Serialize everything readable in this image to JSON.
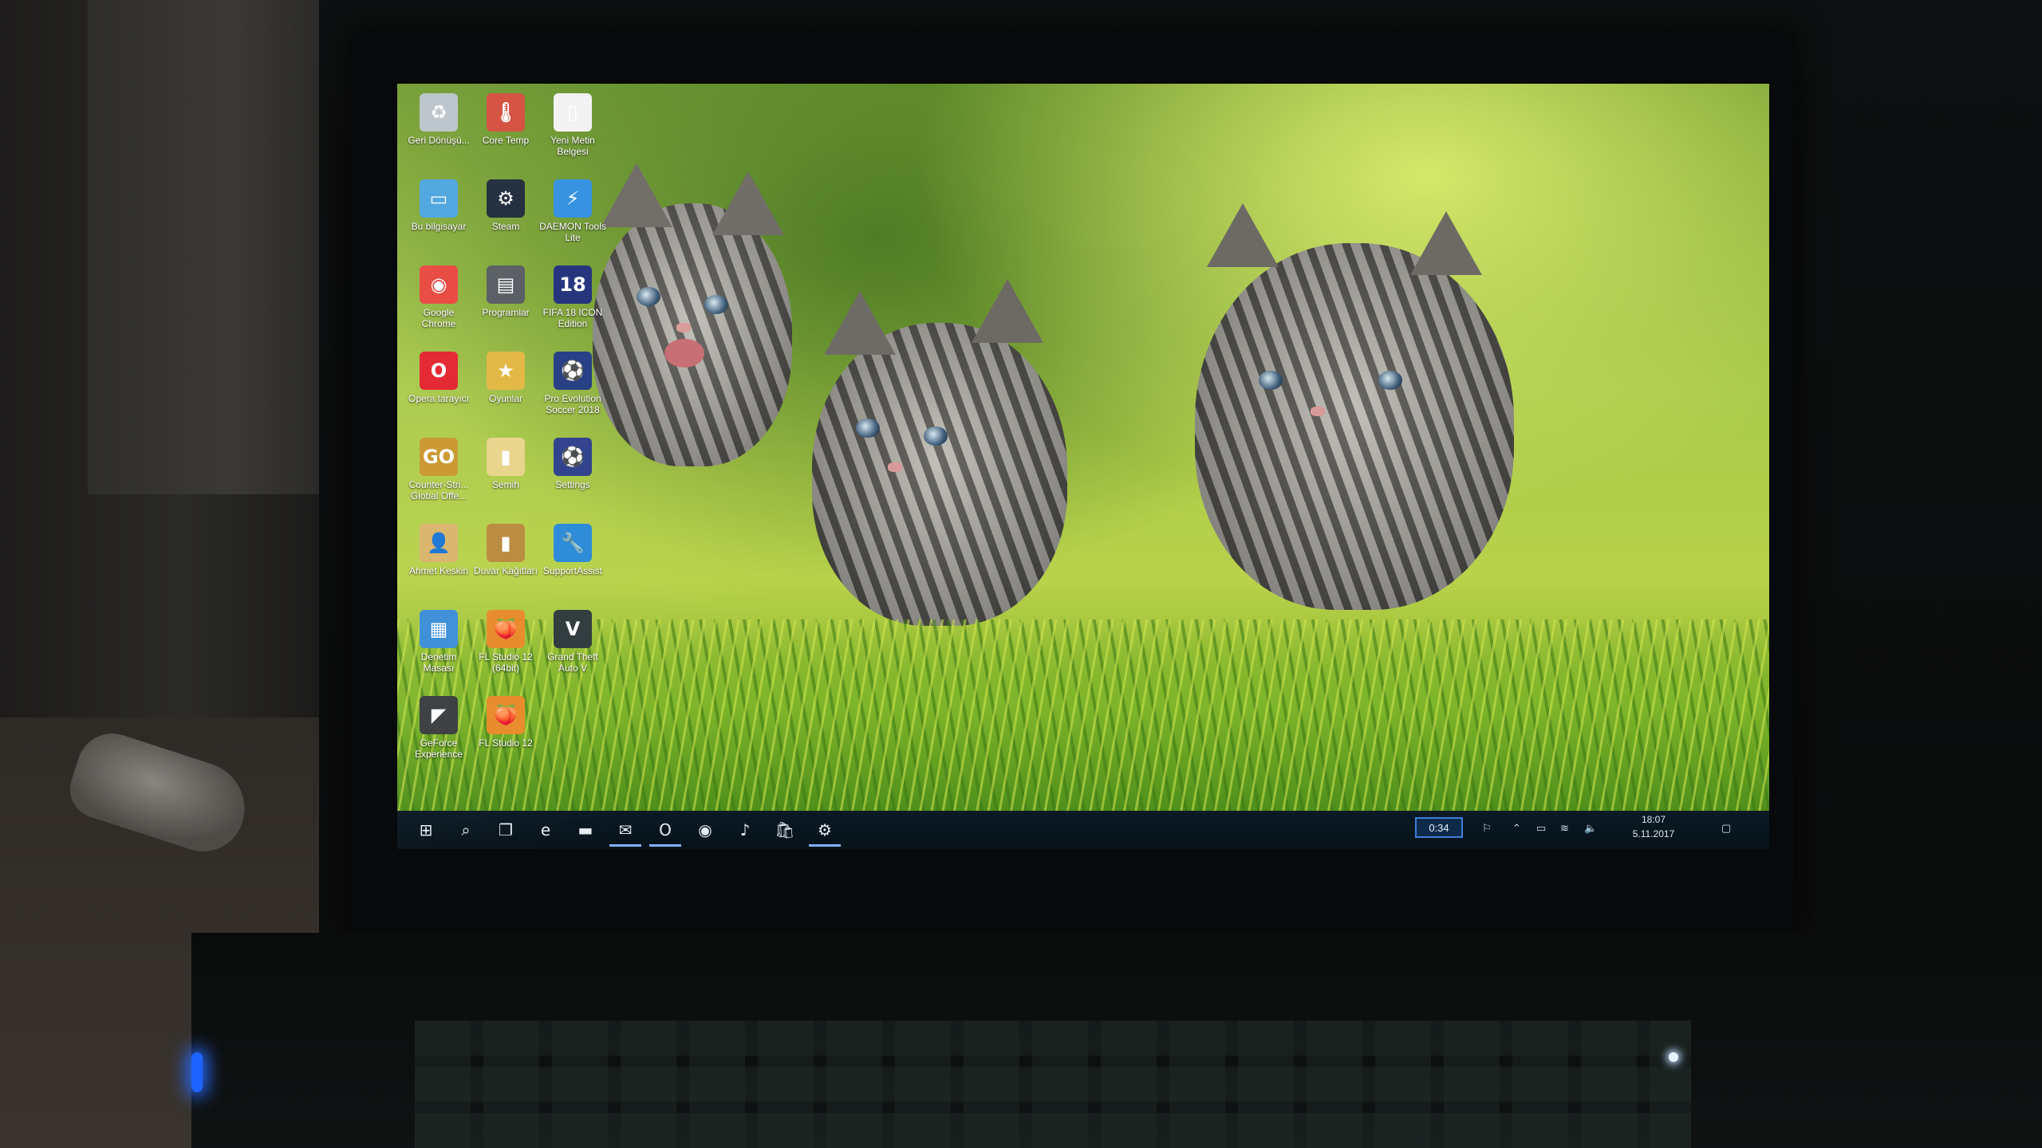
{
  "desktop": {
    "icons": [
      {
        "label": "Geri Dönüşü...",
        "icon": "recycle-bin-icon",
        "glyph": "♻",
        "color": "#b9c3c9"
      },
      {
        "label": "Core Temp",
        "icon": "core-temp-icon",
        "glyph": "🌡",
        "color": "#d34b3a"
      },
      {
        "label": "Yeni Metin Belgesi",
        "icon": "text-document-icon",
        "glyph": "▯",
        "color": "#f2f2f2"
      },
      {
        "label": "Bu bilgisayar",
        "icon": "this-pc-icon",
        "glyph": "▭",
        "color": "#4aa3df"
      },
      {
        "label": "Steam",
        "icon": "steam-icon",
        "glyph": "⚙",
        "color": "#1b2838"
      },
      {
        "label": "DAEMON Tools Lite",
        "icon": "daemon-tools-icon",
        "glyph": "⚡",
        "color": "#2f8fe0"
      },
      {
        "label": "Google Chrome",
        "icon": "chrome-icon",
        "glyph": "◉",
        "color": "#e8453c"
      },
      {
        "label": "Programlar",
        "icon": "folder-programs-icon",
        "glyph": "▤",
        "color": "#555a60"
      },
      {
        "label": "FIFA 18 ICON Edition",
        "icon": "fifa18-icon",
        "glyph": "18",
        "color": "#1d2f7a"
      },
      {
        "label": "Opera tarayıcı",
        "icon": "opera-icon",
        "glyph": "O",
        "color": "#e3212c"
      },
      {
        "label": "Oyunlar",
        "icon": "games-star-icon",
        "glyph": "★",
        "color": "#e2b640"
      },
      {
        "label": "Pro Evolution Soccer 2018",
        "icon": "pes2018-icon",
        "glyph": "⚽",
        "color": "#223a82"
      },
      {
        "label": "Counter-Stri... Global Offe...",
        "icon": "csgo-icon",
        "glyph": "GO",
        "color": "#c9962c"
      },
      {
        "label": "Semih",
        "icon": "folder-semih-icon",
        "glyph": "▮",
        "color": "#e8d48a"
      },
      {
        "label": "Settings",
        "icon": "settings-shortcut-icon",
        "glyph": "⚽",
        "color": "#2c3f8a"
      },
      {
        "label": "Ahmet Keskin",
        "icon": "user-folder-icon",
        "glyph": "👤",
        "color": "#d9b46a"
      },
      {
        "label": "Duvar Kağıtları",
        "icon": "wallpaper-folder-icon",
        "glyph": "▮",
        "color": "#b98a3c"
      },
      {
        "label": "SupportAssist",
        "icon": "supportassist-icon",
        "glyph": "🔧",
        "color": "#2a8ad8"
      },
      {
        "label": "Denetim Masası",
        "icon": "control-panel-icon",
        "glyph": "▦",
        "color": "#3b8ed6"
      },
      {
        "label": "FL Studio 12 (64bit)",
        "icon": "fl-studio-64-icon",
        "glyph": "🍑",
        "color": "#e88a2a"
      },
      {
        "label": "Grand Theft Auto V",
        "icon": "gta5-icon",
        "glyph": "V",
        "color": "#2e3a3c"
      },
      {
        "label": "GeForce Experience",
        "icon": "geforce-icon",
        "glyph": "◤",
        "color": "#3a3e40"
      },
      {
        "label": "FL Studio 12",
        "icon": "fl-studio-icon",
        "glyph": "🍑",
        "color": "#e88a2a"
      }
    ]
  },
  "taskbar": {
    "buttons": [
      {
        "name": "start-icon",
        "glyph": "⊞"
      },
      {
        "name": "search-icon",
        "glyph": "⌕"
      },
      {
        "name": "task-view-icon",
        "glyph": "❐"
      },
      {
        "name": "edge-icon",
        "glyph": "e"
      },
      {
        "name": "file-explorer-icon",
        "glyph": "▬"
      },
      {
        "name": "mail-icon",
        "glyph": "✉"
      },
      {
        "name": "opera-taskbar-icon",
        "glyph": "O"
      },
      {
        "name": "chrome-taskbar-icon",
        "glyph": "◉"
      },
      {
        "name": "fl-studio-taskbar-icon",
        "glyph": "♪"
      },
      {
        "name": "store-icon",
        "glyph": "🛍"
      },
      {
        "name": "settings-gear-icon",
        "glyph": "⚙"
      }
    ],
    "tray": {
      "battery_text": "0:34",
      "clock_time": "18:07",
      "clock_date": "5.11.2017"
    }
  }
}
